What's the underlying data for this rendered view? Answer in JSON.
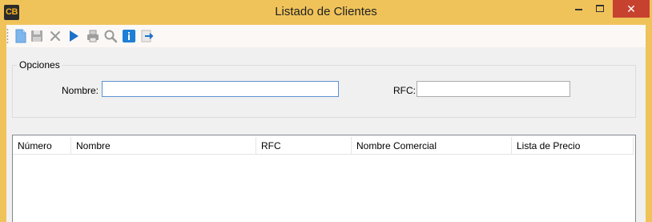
{
  "window": {
    "app_icon_text": "CB",
    "title": "Listado de Clientes",
    "close_glyph": "✕"
  },
  "toolbar": {
    "buttons": [
      {
        "name": "new-icon"
      },
      {
        "name": "save-icon"
      },
      {
        "name": "delete-icon"
      },
      {
        "name": "play-icon"
      },
      {
        "name": "print-icon"
      },
      {
        "name": "search-icon"
      },
      {
        "name": "info-icon"
      },
      {
        "name": "exit-icon"
      }
    ]
  },
  "options": {
    "title": "Opciones",
    "nombre_label": "Nombre:",
    "nombre_value": "",
    "rfc_label": "RFC:",
    "rfc_value": ""
  },
  "grid": {
    "columns": [
      "Número",
      "Nombre",
      "RFC",
      "Nombre Comercial",
      "Lista de Precio"
    ],
    "rows": []
  },
  "colors": {
    "titlebar": "#f0c35a",
    "close_button": "#c7412f",
    "accent_blue": "#1e7fd6"
  }
}
